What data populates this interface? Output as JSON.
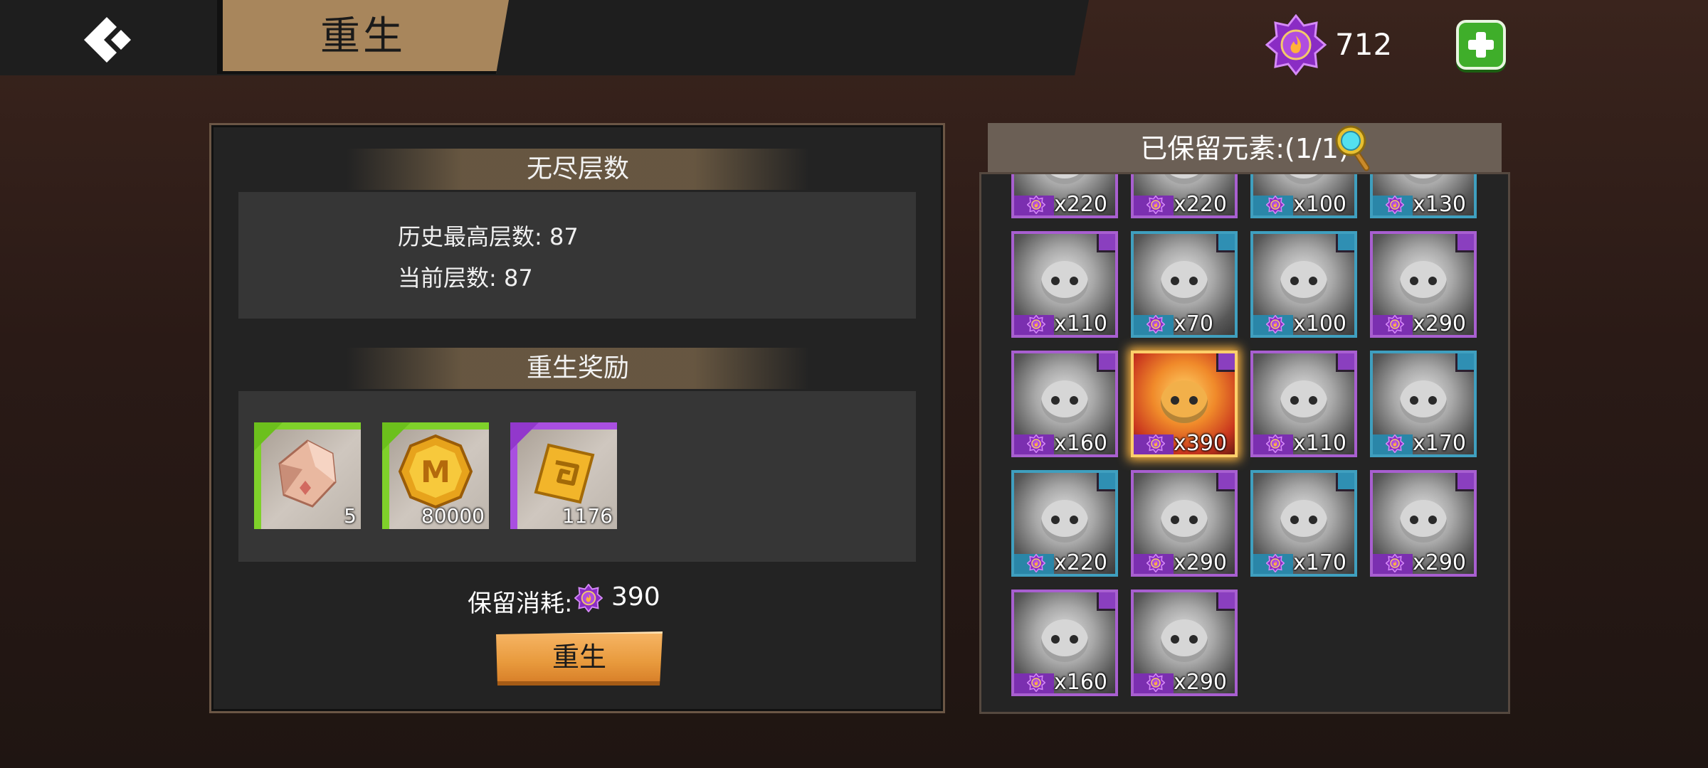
{
  "header": {
    "title": "重生",
    "currency_value": "712",
    "back_icon": "back-arrow-icon",
    "add_icon": "plus-icon"
  },
  "endless": {
    "title": "无尽层数",
    "history_best": "历史最高层数: 87",
    "current": "当前层数: 87"
  },
  "rewards": {
    "title": "重生奖励",
    "items": [
      {
        "icon": "crystal-shard-icon",
        "qty": "5",
        "accent": "#7fd12a"
      },
      {
        "icon": "gold-m-coin-icon",
        "qty": "80000",
        "accent": "#7fd12a"
      },
      {
        "icon": "gold-rune-card-icon",
        "qty": "1176",
        "accent": "#a94fe0"
      }
    ],
    "cost_label": "保留消耗:",
    "cost_value": "390",
    "button_label": "重生"
  },
  "retained": {
    "title": "已保留元素:(1/1)",
    "cards": [
      {
        "cost": "x220",
        "tier": "purple"
      },
      {
        "cost": "x220",
        "tier": "purple"
      },
      {
        "cost": "x100",
        "tier": "teal"
      },
      {
        "cost": "x130",
        "tier": "teal"
      },
      {
        "cost": "x110",
        "tier": "purple"
      },
      {
        "cost": "x70",
        "tier": "teal"
      },
      {
        "cost": "x100",
        "tier": "teal"
      },
      {
        "cost": "x290",
        "tier": "purple"
      },
      {
        "cost": "x160",
        "tier": "purple"
      },
      {
        "cost": "x390",
        "tier": "purple",
        "selected": true
      },
      {
        "cost": "x110",
        "tier": "purple"
      },
      {
        "cost": "x170",
        "tier": "teal"
      },
      {
        "cost": "x220",
        "tier": "teal"
      },
      {
        "cost": "x290",
        "tier": "purple"
      },
      {
        "cost": "x170",
        "tier": "teal"
      },
      {
        "cost": "x290",
        "tier": "purple"
      },
      {
        "cost": "x160",
        "tier": "purple"
      },
      {
        "cost": "x290",
        "tier": "purple"
      }
    ]
  },
  "colors": {
    "purple_tier": "#a85fd0",
    "teal_tier": "#3f9fbf",
    "button_orange": "#e89a3d",
    "title_tab": "#a8865c",
    "add_green": "#3fae2a"
  }
}
